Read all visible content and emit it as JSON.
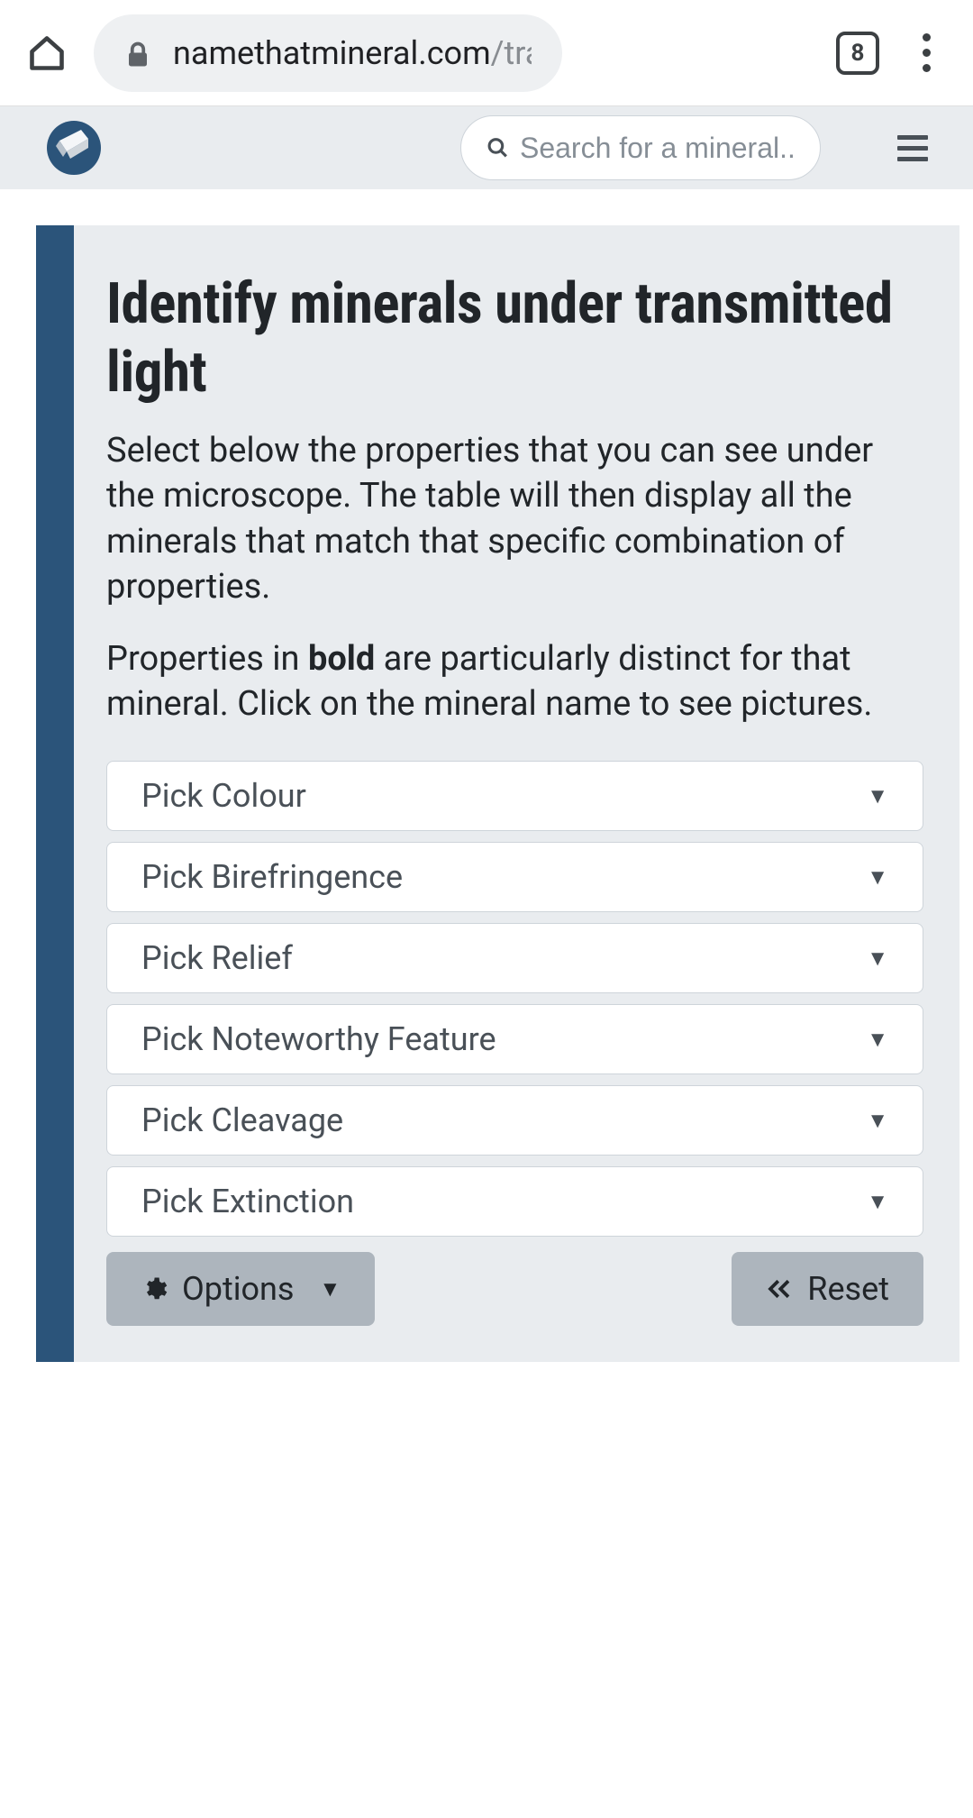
{
  "browser": {
    "url_host": "namethatmineral.com",
    "url_path": "/trans",
    "tab_count": "8"
  },
  "header": {
    "search_placeholder": "Search for a mineral.."
  },
  "main": {
    "title": "Identify minerals under transmitted light",
    "paragraph1": "Select below the properties that you can see under the microscope. The table will then display all the minerals that match that specific combination of properties.",
    "paragraph2_pre": "Properties in ",
    "paragraph2_bold": "bold",
    "paragraph2_post": " are particularly distinct for that mineral. Click on the mineral name to see pictures.",
    "dropdowns": [
      {
        "label": "Pick Colour"
      },
      {
        "label": "Pick Birefringence"
      },
      {
        "label": "Pick Relief"
      },
      {
        "label": "Pick Noteworthy Feature"
      },
      {
        "label": "Pick Cleavage"
      },
      {
        "label": "Pick Extinction"
      }
    ],
    "options_button": "Options",
    "reset_button": "Reset"
  }
}
